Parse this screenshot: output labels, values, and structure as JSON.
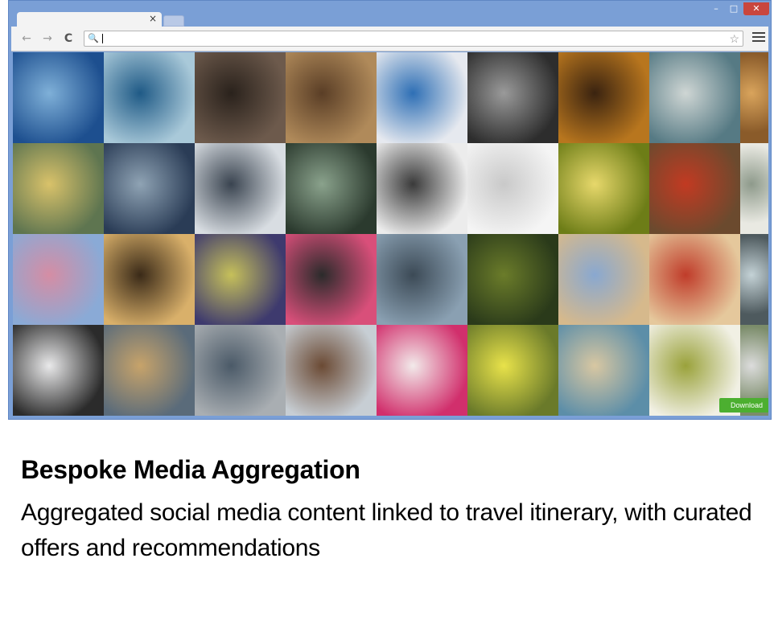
{
  "browser": {
    "tab_close": "×",
    "win_min": "–",
    "win_max": "□",
    "win_close": "✕",
    "back_icon": "←",
    "forward_icon": "→",
    "reload_icon": "C",
    "search_icon": "🔍",
    "star_icon": "☆",
    "address_value": ""
  },
  "gallery": {
    "tiles": [
      [
        "#1d4f8f",
        "#7fb0d8"
      ],
      [
        "#a9c9d9",
        "#1f5a86"
      ],
      [
        "#6d5a4c",
        "#2a221c"
      ],
      [
        "#b08a5a",
        "#5a3e26"
      ],
      [
        "#e6e9ef",
        "#2e6fb5"
      ],
      [
        "#2d2d2d",
        "#9a9a9a"
      ],
      [
        "#b8761e",
        "#3a2310"
      ],
      [
        "#567a84",
        "#cfd6d4"
      ],
      [
        "#8a5b2a",
        "#d9a45c"
      ],
      [
        "#5e7550",
        "#d9c26a"
      ],
      [
        "#2a3c56",
        "#8fa3b4"
      ],
      [
        "#d8dde2",
        "#3a4450"
      ],
      [
        "#2b3a2e",
        "#8aa28c"
      ],
      [
        "#ececec",
        "#3a3a3a"
      ],
      [
        "#f5f5f5",
        "#c9c9c9"
      ],
      [
        "#6d7d17",
        "#e7d86b"
      ],
      [
        "#6b4a2e",
        "#c23a22"
      ],
      [
        "#e9e9e2",
        "#8e9a8b"
      ],
      [
        "#8aaad6",
        "#d58da4"
      ],
      [
        "#d9b06a",
        "#3a2a18"
      ],
      [
        "#3e3a6e",
        "#c6c05a"
      ],
      [
        "#d94f7a",
        "#2b2b2b"
      ],
      [
        "#8aa0b2",
        "#3c4a56"
      ],
      [
        "#2a3a1a",
        "#6b7c2a"
      ],
      [
        "#d6b98c",
        "#89a8d0"
      ],
      [
        "#e5c89c",
        "#c03c2a"
      ],
      [
        "#4e5a5e",
        "#c4d2d6"
      ],
      [
        "#2b2b2b",
        "#e9e9ea"
      ],
      [
        "#5a6b7a",
        "#c7a36a"
      ],
      [
        "#a9aeb2",
        "#4b5a68"
      ],
      [
        "#c7ced4",
        "#6b4a34"
      ],
      [
        "#d12f6c",
        "#f2eaea"
      ],
      [
        "#6a7a2a",
        "#e8e24a"
      ],
      [
        "#5c8ea8",
        "#d8c7a2"
      ],
      [
        "#f1f0e4",
        "#9aa23b"
      ],
      [
        "#7b8c6a",
        "#dcdcdc"
      ]
    ],
    "download_label": "Download"
  },
  "caption": {
    "title": "Bespoke Media Aggregation",
    "body": "Aggregated social media content linked to travel itinerary, with curated offers and recommendations"
  }
}
